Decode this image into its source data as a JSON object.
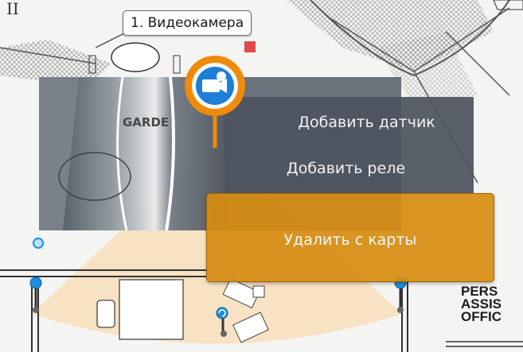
{
  "camera": {
    "tooltip": "1. Видеокамера",
    "icon": "camera-icon"
  },
  "preview": {
    "sign_text": "GARDE"
  },
  "context_menu": {
    "items": [
      {
        "label": "Добавить датчик"
      },
      {
        "label": "Добавить реле"
      }
    ],
    "delete_label": "Удалить с карты"
  },
  "map": {
    "room_label_lines": [
      "PERS",
      "ASSIS",
      "OFFIC"
    ],
    "pin_color": "#1d8fe0",
    "accent_color": "#f08a0a",
    "view_cone_color": "#f8dcb4"
  }
}
